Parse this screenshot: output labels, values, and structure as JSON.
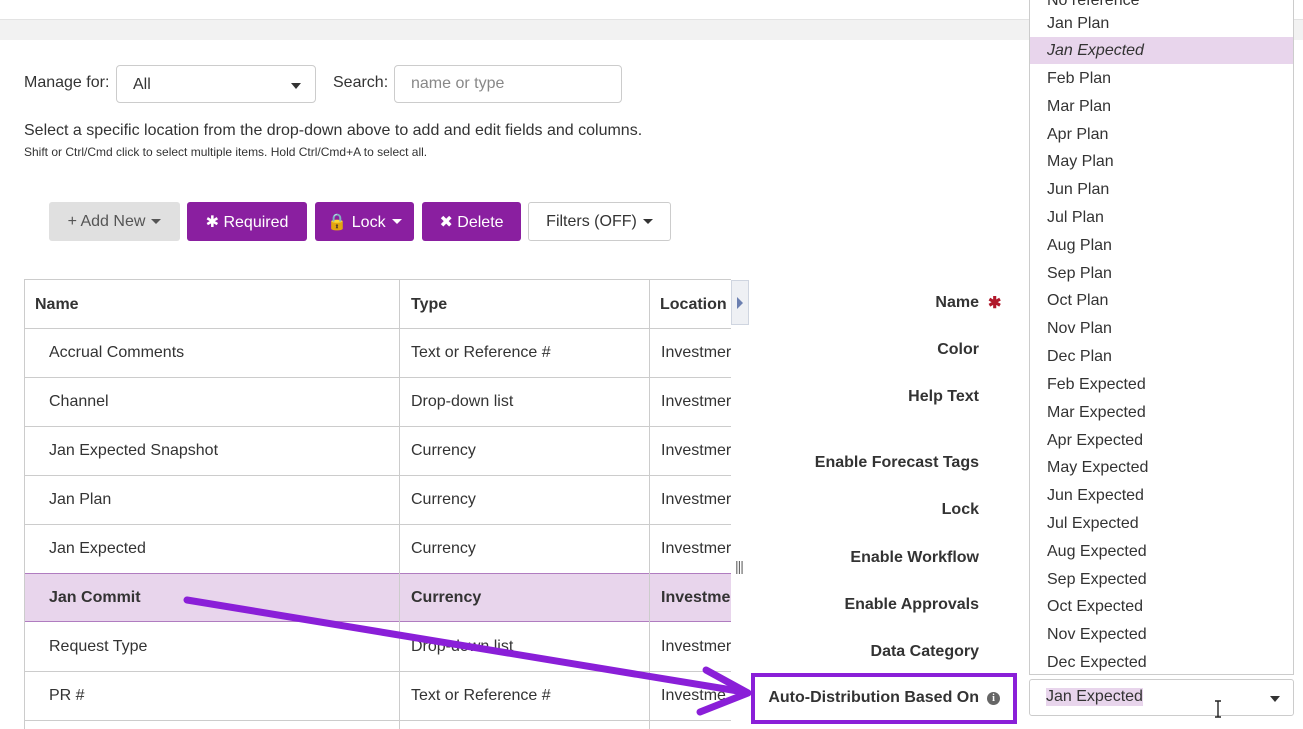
{
  "manage_for": {
    "label": "Manage for:",
    "value": "All"
  },
  "search": {
    "label": "Search:",
    "placeholder": "name or type"
  },
  "hints": {
    "line1": "Select a specific location from the drop-down above to add and edit fields and columns.",
    "line2": "Shift or Ctrl/Cmd click to select multiple items. Hold Ctrl/Cmd+A to select all."
  },
  "toolbar": {
    "add_new": "+ Add New",
    "required": "✱ Required",
    "lock": "🔒 Lock",
    "delete": "✖ Delete",
    "filters": "Filters (OFF)"
  },
  "table": {
    "headers": {
      "name": "Name",
      "type": "Type",
      "location": "Location"
    },
    "rows": [
      {
        "name": "Accrual Comments",
        "type": "Text or Reference #",
        "location": "Investmer"
      },
      {
        "name": "Channel",
        "type": "Drop-down list",
        "location": "Investmer"
      },
      {
        "name": "Jan Expected Snapshot",
        "type": "Currency",
        "location": "Investmer"
      },
      {
        "name": "Jan Plan",
        "type": "Currency",
        "location": "Investmer"
      },
      {
        "name": "Jan Expected",
        "type": "Currency",
        "location": "Investmer"
      },
      {
        "name": "Jan Commit",
        "type": "Currency",
        "location": "Investme"
      },
      {
        "name": "Request Type",
        "type": "Drop-down list",
        "location": "Investmer"
      },
      {
        "name": "PR #",
        "type": "Text or Reference #",
        "location": "Investme"
      }
    ]
  },
  "form": {
    "name": "Name",
    "color": "Color",
    "help_text": "Help Text",
    "enable_forecast_tags": "Enable Forecast Tags",
    "lock": "Lock",
    "enable_workflow": "Enable Workflow",
    "enable_approvals": "Enable Approvals",
    "data_category": "Data Category",
    "auto_distribution": "Auto-Distribution Based On"
  },
  "dropdown": {
    "selected": "Jan Expected",
    "options": [
      "No reference",
      "Jan Plan",
      "Jan Expected",
      "Feb Plan",
      "Mar Plan",
      "Apr Plan",
      "May Plan",
      "Jun Plan",
      "Jul Plan",
      "Aug Plan",
      "Sep Plan",
      "Oct Plan",
      "Nov Plan",
      "Dec Plan",
      "Feb Expected",
      "Mar Expected",
      "Apr Expected",
      "May Expected",
      "Jun Expected",
      "Jul Expected",
      "Aug Expected",
      "Sep Expected",
      "Oct Expected",
      "Nov Expected",
      "Dec Expected"
    ]
  },
  "colors": {
    "accent_purple": "#8a1fa0",
    "selection_purple": "#e8d5ec",
    "arrow_purple": "#8a1fd8",
    "required_red": "#b0182a"
  }
}
